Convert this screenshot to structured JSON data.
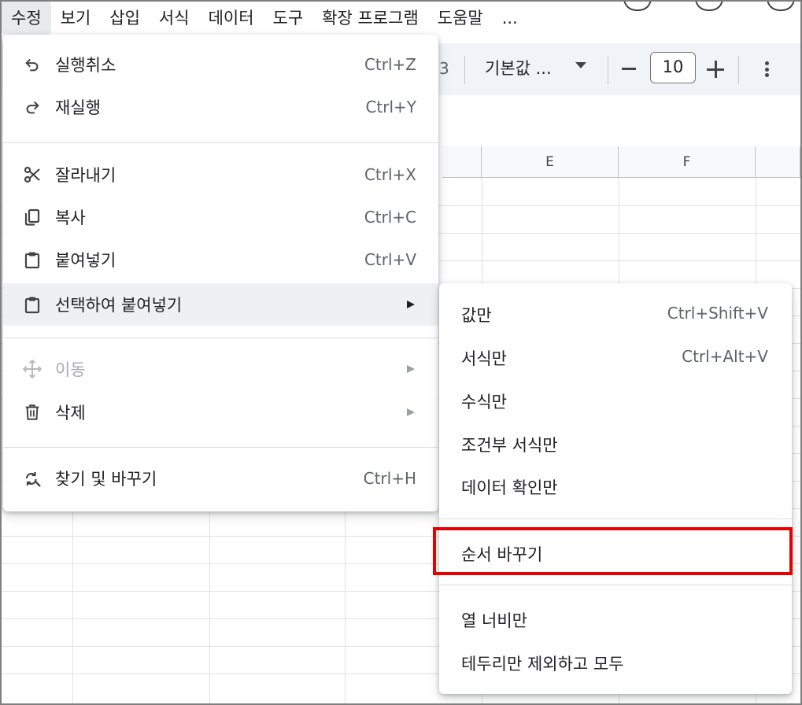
{
  "menubar": {
    "items": [
      "수정",
      "보기",
      "삽입",
      "서식",
      "데이터",
      "도구",
      "확장 프로그램",
      "도움말",
      "..."
    ]
  },
  "toolbar": {
    "partial_text": "3",
    "font": "기본값 ...",
    "font_size": "10"
  },
  "grid": {
    "columns": [
      "E",
      "F"
    ]
  },
  "edit_menu": {
    "items": [
      {
        "icon": "undo-icon",
        "label": "실행취소",
        "shortcut": "Ctrl+Z"
      },
      {
        "icon": "redo-icon",
        "label": "재실행",
        "shortcut": "Ctrl+Y"
      },
      {
        "icon": "scissors-icon",
        "label": "잘라내기",
        "shortcut": "Ctrl+X"
      },
      {
        "icon": "copy-icon",
        "label": "복사",
        "shortcut": "Ctrl+C"
      },
      {
        "icon": "clipboard-icon",
        "label": "붙여넣기",
        "shortcut": "Ctrl+V"
      },
      {
        "icon": "clipboard-icon",
        "label": "선택하여 붙여넣기",
        "shortcut": ""
      },
      {
        "icon": "move-icon",
        "label": "이동",
        "shortcut": ""
      },
      {
        "icon": "trash-icon",
        "label": "삭제",
        "shortcut": ""
      },
      {
        "icon": "find-replace-icon",
        "label": "찾기 및 바꾸기",
        "shortcut": "Ctrl+H"
      }
    ]
  },
  "paste_special_menu": {
    "items": [
      {
        "label": "값만",
        "shortcut": "Ctrl+Shift+V"
      },
      {
        "label": "서식만",
        "shortcut": "Ctrl+Alt+V"
      },
      {
        "label": "수식만",
        "shortcut": ""
      },
      {
        "label": "조건부 서식만",
        "shortcut": ""
      },
      {
        "label": "데이터 확인만",
        "shortcut": ""
      },
      {
        "label": "순서 바꾸기",
        "shortcut": ""
      },
      {
        "label": "열 너비만",
        "shortcut": ""
      },
      {
        "label": "테두리만 제외하고 모두",
        "shortcut": ""
      }
    ]
  },
  "colors": {
    "highlight": "#e60000",
    "hover": "#eef0f3",
    "toolbar_bg": "#f0f4f9"
  }
}
